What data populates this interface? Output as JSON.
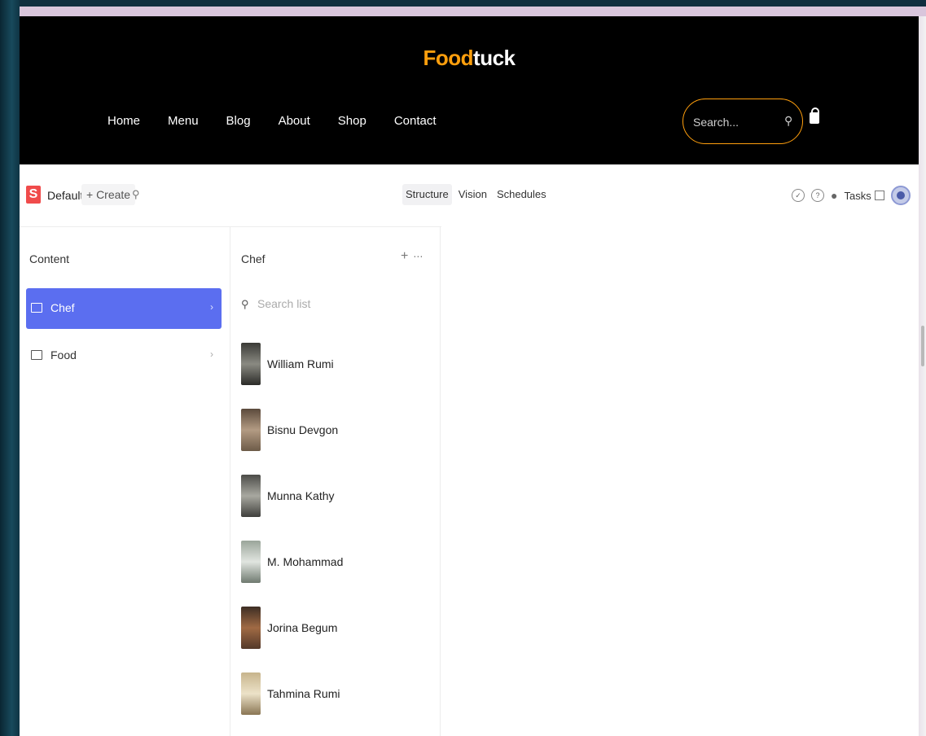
{
  "site": {
    "brand_part1": "Food",
    "brand_part2": "tuck",
    "nav": [
      "Home",
      "Menu",
      "Blog",
      "About",
      "Shop",
      "Contact"
    ],
    "search_placeholder": "Search..."
  },
  "toolbar": {
    "logo_letter": "S",
    "workspace": "Default",
    "create_label": "+ Create",
    "tabs": [
      "Structure",
      "Vision",
      "Schedules"
    ],
    "active_tab": "Structure",
    "tasks_label": "Tasks"
  },
  "content_pane": {
    "title": "Content",
    "items": [
      {
        "label": "Chef",
        "active": true
      },
      {
        "label": "Food",
        "active": false
      }
    ]
  },
  "list_pane": {
    "title": "Chef",
    "search_placeholder": "Search list",
    "documents": [
      {
        "name": "William Rumi"
      },
      {
        "name": "Bisnu Devgon"
      },
      {
        "name": "Munna Kathy"
      },
      {
        "name": "M. Mohammad"
      },
      {
        "name": "Jorina Begum"
      },
      {
        "name": "Tahmina Rumi"
      }
    ]
  },
  "colors": {
    "brand_accent": "#ff9f0d",
    "header_bg": "#000000",
    "active_item": "#5b6ef0",
    "logo_red": "#f04b4b"
  }
}
